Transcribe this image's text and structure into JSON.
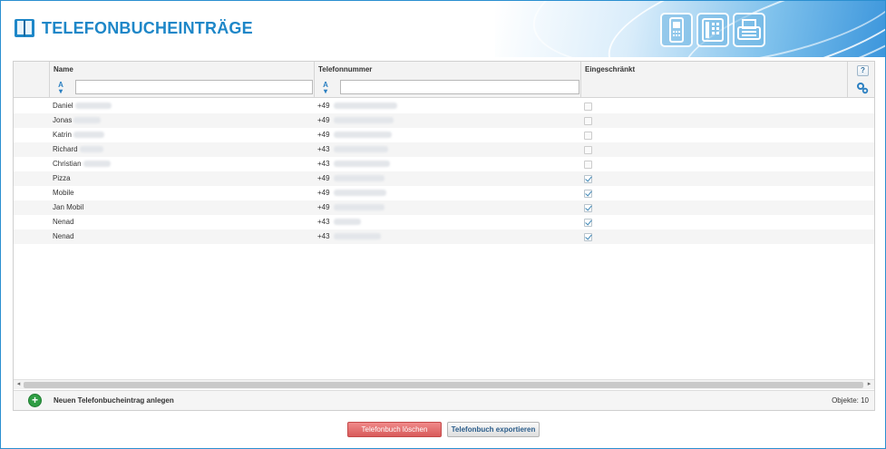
{
  "header": {
    "title": "TELEFONBUCHEINTRÄGE",
    "icons": [
      "book-icon",
      "mobile-phone-icon",
      "desk-phone-icon",
      "fax-icon"
    ]
  },
  "table": {
    "columns": [
      "Name",
      "Telefonnummer",
      "Eingeschränkt"
    ],
    "filters": {
      "name": "",
      "phone": ""
    },
    "help_label": "?",
    "rows": [
      {
        "name": "Daniel",
        "phone": "+49",
        "restricted": false
      },
      {
        "name": "Jonas",
        "phone": "+49",
        "restricted": false
      },
      {
        "name": "Katrin",
        "phone": "+49",
        "restricted": false
      },
      {
        "name": "Richard",
        "phone": "+43",
        "restricted": false
      },
      {
        "name": "Christian",
        "phone": "+43",
        "restricted": false
      },
      {
        "name": "Pizza",
        "phone": "+49",
        "restricted": true
      },
      {
        "name": "Mobile",
        "phone": "+49",
        "restricted": true
      },
      {
        "name": "Jan Mobil",
        "phone": "+49",
        "restricted": true
      },
      {
        "name": "Nenad",
        "phone": "+43",
        "restricted": true
      },
      {
        "name": "Nenad",
        "phone": "+43",
        "restricted": true
      }
    ],
    "add_label": "Neuen Telefonbucheintrag anlegen",
    "count_label": "Objekte: 10"
  },
  "buttons": {
    "delete_label": "Telefonbuch löschen",
    "export_label": "Telefonbuch exportieren"
  },
  "colors": {
    "accent": "#1e87c8",
    "delete_button": "#d85a5a",
    "add_icon": "#2f9e44"
  }
}
